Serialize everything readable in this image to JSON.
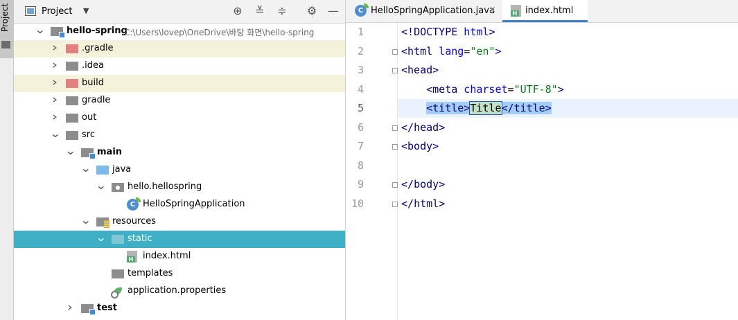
{
  "side_strip": {
    "label": "Project"
  },
  "project_panel": {
    "title": "Project",
    "tree": [
      {
        "label": "hello-spring",
        "path": "C:\\Users\\lovep\\OneDrive\\바탕 화면\\hello-spring",
        "depth": 0,
        "arrow": "down",
        "icon": "module",
        "bold": true
      },
      {
        "label": ".gradle",
        "depth": 1,
        "arrow": "right",
        "icon": "folder-excluded",
        "excluded": true
      },
      {
        "label": ".idea",
        "depth": 1,
        "arrow": "right",
        "icon": "folder"
      },
      {
        "label": "build",
        "depth": 1,
        "arrow": "right",
        "icon": "folder-excluded",
        "excluded": true
      },
      {
        "label": "gradle",
        "depth": 1,
        "arrow": "right",
        "icon": "folder"
      },
      {
        "label": "out",
        "depth": 1,
        "arrow": "right",
        "icon": "folder"
      },
      {
        "label": "src",
        "depth": 1,
        "arrow": "down",
        "icon": "folder"
      },
      {
        "label": "main",
        "depth": 2,
        "arrow": "down",
        "icon": "module",
        "bold": true
      },
      {
        "label": "java",
        "depth": 3,
        "arrow": "down",
        "icon": "folder-source"
      },
      {
        "label": "hello.hellospring",
        "depth": 4,
        "arrow": "down",
        "icon": "package"
      },
      {
        "label": "HelloSpringApplication",
        "depth": 5,
        "arrow": "",
        "icon": "spring-class"
      },
      {
        "label": "resources",
        "depth": 3,
        "arrow": "down",
        "icon": "folder-resources"
      },
      {
        "label": "static",
        "depth": 4,
        "arrow": "down",
        "icon": "folder",
        "selected": true
      },
      {
        "label": "index.html",
        "depth": 5,
        "arrow": "",
        "icon": "html-file"
      },
      {
        "label": "templates",
        "depth": 4,
        "arrow": "",
        "icon": "folder"
      },
      {
        "label": "application.properties",
        "depth": 4,
        "arrow": "",
        "icon": "properties-file"
      },
      {
        "label": "test",
        "depth": 2,
        "arrow": "right",
        "icon": "module",
        "bold": true
      }
    ]
  },
  "editor": {
    "tabs": [
      {
        "label": "HelloSpringApplication.java",
        "close": "×",
        "icon": "spring-class",
        "active": false
      },
      {
        "label": "index.html",
        "close": "",
        "icon": "html-file",
        "active": true
      }
    ],
    "line_numbers": [
      "1",
      "2",
      "3",
      "4",
      "5",
      "6",
      "7",
      "8",
      "9",
      "10"
    ],
    "lines": [
      "<!DOCTYPE html>",
      "<html lang=\"en\">",
      "<head>",
      "    <meta charset=\"UTF-8\">",
      "    <title>Title</title>",
      "</head>",
      "<body>",
      "",
      "</body>",
      "</html>"
    ],
    "current_line": 5
  }
}
